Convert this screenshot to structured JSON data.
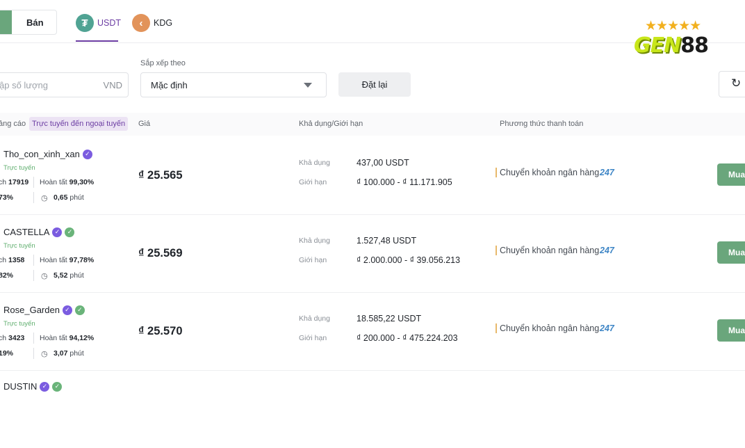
{
  "toggle": {
    "sell_label": "Bán"
  },
  "coins": [
    {
      "symbol": "USDT",
      "icon_glyph": "₮",
      "icon": "tether-icon",
      "color": "#50a393",
      "active": true
    },
    {
      "symbol": "KDG",
      "icon_glyph": "‹",
      "icon": "kdg-coin-icon",
      "color": "#e2935a",
      "active": false
    }
  ],
  "logo": {
    "stars": "★★★★★",
    "word_a": "GEN",
    "word_b": "88"
  },
  "filters": {
    "amount_placeholder": "ập số lượng",
    "amount_unit": "VND",
    "sort_label": "Sắp xếp theo",
    "sort_value": "Mặc định",
    "reset_label": "Đặt lại",
    "refresh_glyph": "↻"
  },
  "table": {
    "headers": {
      "advertiser": "ảng cáo",
      "online_chip": "Trực tuyến đến ngoại tuyến",
      "price": "Giá",
      "available_limit": "Khả dụng/Giới hạn",
      "payment": "Phương thức thanh toán"
    },
    "labels": {
      "available": "Khả dụng",
      "limit": "Giới hạn",
      "minutes": "phút",
      "completion": "Hoàn tất",
      "trades_prefix": "ch",
      "buy": "Mua",
      "payment_method": "Chuyển khoản ngân hàng",
      "payment_logo": "247",
      "clock_glyph": "◷",
      "check_glyph": "✓"
    },
    "rows": [
      {
        "name": "Tho_con_xinh_xan",
        "status": "Trực tuyến",
        "trades": "17919",
        "completion_rate": "99,30%",
        "rate": "73%",
        "time": "0,65",
        "price": "₫ 25.565",
        "available": "437,00 USDT",
        "limit": "₫ 100.000 - ₫ 11.171.905",
        "green_badge": false
      },
      {
        "name": "CASTELLA",
        "status": "Trực tuyến",
        "trades": "1358",
        "completion_rate": "97,78%",
        "rate": "82%",
        "time": "5,52",
        "price": "₫ 25.569",
        "available": "1.527,48 USDT",
        "limit": "₫ 2.000.000 - ₫ 39.056.213",
        "green_badge": true
      },
      {
        "name": "Rose_Garden",
        "status": "Trực tuyến",
        "trades": "3423",
        "completion_rate": "94,12%",
        "rate": "19%",
        "time": "3,07",
        "price": "₫ 25.570",
        "available": "18.585,22 USDT",
        "limit": "₫ 200.000 - ₫ 475.224.203",
        "green_badge": true
      },
      {
        "name": "DUSTIN",
        "green_badge": true
      }
    ]
  }
}
